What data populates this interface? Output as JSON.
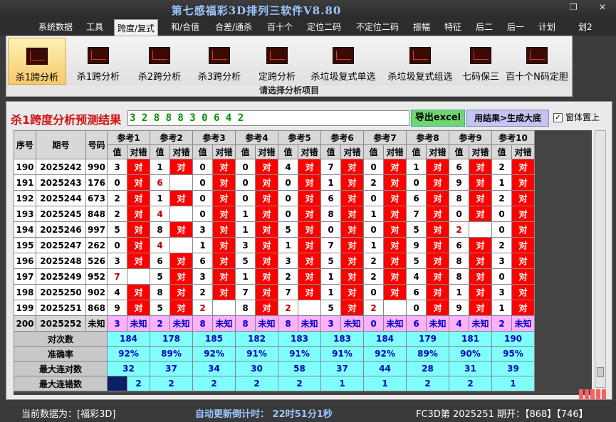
{
  "window": {
    "title": "第七感福彩3D排列三软件V8.80",
    "restore_glyph": "❐",
    "close_glyph": "✕"
  },
  "menu": [
    "系统数据",
    "工具",
    "跨度/复式",
    "和/合值",
    "合差/通杀",
    "百十个",
    "定位二码",
    "不定位二码",
    "振幅",
    "特征",
    "后二",
    "后一",
    "计划",
    "划2"
  ],
  "ribbon": {
    "buttons": [
      "杀1跨分析",
      "杀1跨分析",
      "杀2跨分析",
      "杀3跨分析",
      "定跨分析",
      "杀垃圾复式单选",
      "杀垃圾复式组选",
      "七码保三",
      "百十个N码定胆"
    ],
    "caption": "请选择分析项目"
  },
  "result": {
    "title": "杀1跨度分析预测结果",
    "digits": "3 2 8 8 8 3 0 6 4 2",
    "excel_button": "导出excel",
    "gen_button": "用结果>生成大底",
    "ontop_label": "窗体置上",
    "ontop_check": "✓"
  },
  "table": {
    "fixed_headers": [
      "序号",
      "期号",
      "号码"
    ],
    "ref_headers": [
      "参考1",
      "参考2",
      "参考3",
      "参考4",
      "参考5",
      "参考6",
      "参考7",
      "参考8",
      "参考9",
      "参考10"
    ],
    "sub_val": "值",
    "sub_mark": "对错",
    "hit_text": "对",
    "rows": [
      {
        "seq": "190",
        "issue": "2025242",
        "num": "990",
        "cells": [
          [
            "3",
            1
          ],
          [
            "1",
            1
          ],
          [
            "0",
            1
          ],
          [
            "0",
            1
          ],
          [
            "4",
            1
          ],
          [
            "7",
            1
          ],
          [
            "0",
            1
          ],
          [
            "1",
            1
          ],
          [
            "6",
            1
          ],
          [
            "2",
            1
          ]
        ]
      },
      {
        "seq": "191",
        "issue": "2025243",
        "num": "176",
        "cells": [
          [
            "0",
            1
          ],
          [
            "6",
            0
          ],
          [
            "0",
            1
          ],
          [
            "0",
            1
          ],
          [
            "0",
            1
          ],
          [
            "1",
            1
          ],
          [
            "2",
            1
          ],
          [
            "0",
            1
          ],
          [
            "9",
            1
          ],
          [
            "1",
            1
          ]
        ]
      },
      {
        "seq": "192",
        "issue": "2025244",
        "num": "673",
        "cells": [
          [
            "2",
            1
          ],
          [
            "1",
            1
          ],
          [
            "0",
            1
          ],
          [
            "0",
            1
          ],
          [
            "0",
            1
          ],
          [
            "6",
            1
          ],
          [
            "0",
            1
          ],
          [
            "6",
            1
          ],
          [
            "8",
            1
          ],
          [
            "2",
            1
          ]
        ]
      },
      {
        "seq": "193",
        "issue": "2025245",
        "num": "848",
        "cells": [
          [
            "2",
            1
          ],
          [
            "4",
            0
          ],
          [
            "0",
            1
          ],
          [
            "1",
            1
          ],
          [
            "0",
            1
          ],
          [
            "8",
            1
          ],
          [
            "1",
            1
          ],
          [
            "7",
            1
          ],
          [
            "0",
            1
          ],
          [
            "0",
            1
          ]
        ]
      },
      {
        "seq": "194",
        "issue": "2025246",
        "num": "997",
        "cells": [
          [
            "5",
            1
          ],
          [
            "8",
            1
          ],
          [
            "3",
            1
          ],
          [
            "1",
            1
          ],
          [
            "5",
            1
          ],
          [
            "0",
            1
          ],
          [
            "0",
            1
          ],
          [
            "5",
            1
          ],
          [
            "2",
            0
          ],
          [
            "0",
            1
          ]
        ]
      },
      {
        "seq": "195",
        "issue": "2025247",
        "num": "262",
        "cells": [
          [
            "0",
            1
          ],
          [
            "4",
            0
          ],
          [
            "1",
            1
          ],
          [
            "3",
            1
          ],
          [
            "1",
            1
          ],
          [
            "7",
            1
          ],
          [
            "1",
            1
          ],
          [
            "9",
            1
          ],
          [
            "6",
            1
          ],
          [
            "2",
            1
          ]
        ]
      },
      {
        "seq": "196",
        "issue": "2025248",
        "num": "526",
        "cells": [
          [
            "3",
            1
          ],
          [
            "6",
            1
          ],
          [
            "6",
            1
          ],
          [
            "5",
            1
          ],
          [
            "3",
            1
          ],
          [
            "5",
            1
          ],
          [
            "2",
            1
          ],
          [
            "5",
            1
          ],
          [
            "8",
            1
          ],
          [
            "3",
            1
          ]
        ]
      },
      {
        "seq": "197",
        "issue": "2025249",
        "num": "952",
        "cells": [
          [
            "7",
            0
          ],
          [
            "5",
            1
          ],
          [
            "3",
            1
          ],
          [
            "1",
            1
          ],
          [
            "2",
            1
          ],
          [
            "1",
            1
          ],
          [
            "2",
            1
          ],
          [
            "4",
            1
          ],
          [
            "8",
            1
          ],
          [
            "0",
            1
          ]
        ]
      },
      {
        "seq": "198",
        "issue": "2025250",
        "num": "902",
        "cells": [
          [
            "4",
            1
          ],
          [
            "8",
            1
          ],
          [
            "2",
            1
          ],
          [
            "7",
            1
          ],
          [
            "7",
            1
          ],
          [
            "1",
            1
          ],
          [
            "0",
            1
          ],
          [
            "6",
            1
          ],
          [
            "1",
            1
          ],
          [
            "3",
            1
          ]
        ]
      },
      {
        "seq": "199",
        "issue": "2025251",
        "num": "868",
        "cells": [
          [
            "9",
            1
          ],
          [
            "5",
            1
          ],
          [
            "2",
            0
          ],
          [
            "8",
            1
          ],
          [
            "2",
            0
          ],
          [
            "5",
            1
          ],
          [
            "2",
            0
          ],
          [
            "0",
            1
          ],
          [
            "9",
            1
          ],
          [
            "1",
            1
          ]
        ]
      }
    ],
    "predict_row": {
      "seq": "200",
      "issue": "2025252",
      "num": "未知",
      "unknown": "未知",
      "values": [
        "3",
        "2",
        "8",
        "8",
        "8",
        "3",
        "0",
        "6",
        "4",
        "2"
      ]
    },
    "stats": [
      {
        "name": "对次数",
        "values": [
          "184",
          "178",
          "185",
          "182",
          "183",
          "183",
          "184",
          "179",
          "181",
          "190"
        ]
      },
      {
        "name": "准确率",
        "values": [
          "92%",
          "89%",
          "92%",
          "91%",
          "91%",
          "91%",
          "92%",
          "89%",
          "90%",
          "95%"
        ]
      },
      {
        "name": "最大连对数",
        "values": [
          "32",
          "37",
          "34",
          "30",
          "58",
          "37",
          "44",
          "28",
          "31",
          "39"
        ]
      },
      {
        "name": "最大连错数",
        "values": [
          "2",
          "2",
          "2",
          "2",
          "2",
          "1",
          "1",
          "2",
          "2",
          "1"
        ]
      }
    ]
  },
  "status": {
    "current_label": "当前数据为：[福彩3D]",
    "countdown": "自动更新倒计时：   22时51分1秒",
    "draw_info": "FC3D第  2025251 期开：【868】【746】"
  },
  "colors": {
    "hit_red": "#ff0000",
    "predict_pink": "#ffb0ff",
    "stats_cyan": "#80ffff",
    "result_green": "#009000",
    "title_red": "#d01010"
  }
}
